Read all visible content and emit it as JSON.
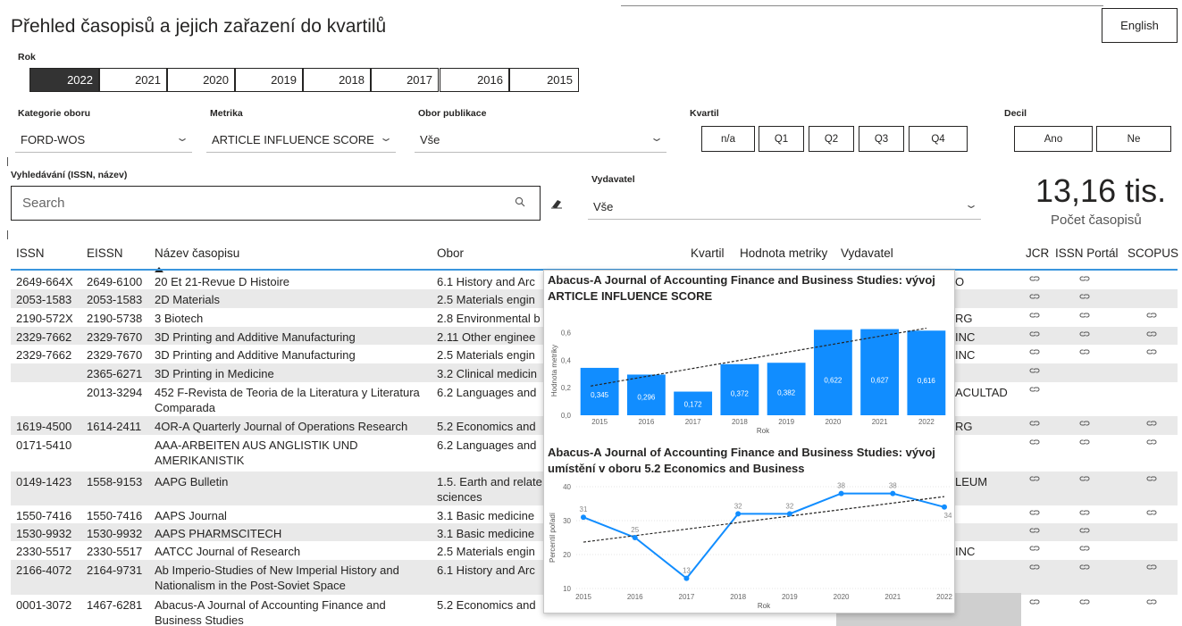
{
  "header": {
    "title": "Přehled časopisů a jejich zařazení do kvartilů",
    "language_button": "English"
  },
  "filters": {
    "year_label": "Rok",
    "years": [
      "2022",
      "2021",
      "2020",
      "2019",
      "2018",
      "2017",
      "2016",
      "2015"
    ],
    "selected_year": "2022",
    "category_label": "Kategorie oboru",
    "category_value": "FORD-WOS",
    "metric_label": "Metrika",
    "metric_value": "ARTICLE INFLUENCE SCORE",
    "field_label": "Obor publikace",
    "field_value": "Vše",
    "quartile_label": "Kvartil",
    "quartiles": [
      "n/a",
      "Q1",
      "Q2",
      "Q3",
      "Q4"
    ],
    "decile_label": "Decil",
    "deciles": [
      "Ano",
      "Ne"
    ],
    "search_label": "Vyhledávání (ISSN, název)",
    "search_placeholder": "Search",
    "publisher_label": "Vydavatel",
    "publisher_value": "Vše"
  },
  "kpi": {
    "value": "13,16 tis.",
    "label": "Počet časopisů"
  },
  "table": {
    "columns": {
      "issn": "ISSN",
      "eissn": "EISSN",
      "name": "Název časopisu",
      "field": "Obor",
      "quartile": "Kvartil",
      "metric": "Hodnota metriky",
      "publisher": "Vydavatel",
      "jcr": "JCR",
      "issn_portal": "ISSN Portál",
      "scopus": "SCOPUS"
    },
    "rows": [
      {
        "issn": "2649-664X",
        "eissn": "2649-6100",
        "name": "20 Et 21-Revue D Histoire",
        "field": "6.1 History and Arc",
        "publisher": "O",
        "jcr": true,
        "portal": true,
        "scopus": false
      },
      {
        "issn": "2053-1583",
        "eissn": "2053-1583",
        "name": "2D Materials",
        "field": "2.5 Materials engin",
        "publisher": "",
        "jcr": true,
        "portal": true,
        "scopus": false
      },
      {
        "issn": "2190-572X",
        "eissn": "2190-5738",
        "name": "3 Biotech",
        "field": "2.8 Environmental b",
        "publisher": "RG",
        "jcr": true,
        "portal": true,
        "scopus": true
      },
      {
        "issn": "2329-7662",
        "eissn": "2329-7670",
        "name": "3D Printing and Additive Manufacturing",
        "field": "2.11 Other enginee",
        "publisher": "INC",
        "jcr": true,
        "portal": true,
        "scopus": true
      },
      {
        "issn": "2329-7662",
        "eissn": "2329-7670",
        "name": "3D Printing and Additive Manufacturing",
        "field": "2.5 Materials engin",
        "publisher": "INC",
        "jcr": true,
        "portal": true,
        "scopus": true
      },
      {
        "issn": "",
        "eissn": "2365-6271",
        "name": "3D Printing in Medicine",
        "field": "3.2 Clinical medicin",
        "publisher": "",
        "jcr": true,
        "portal": false,
        "scopus": false
      },
      {
        "issn": "",
        "eissn": "2013-3294",
        "name": "452 F-Revista de Teoria de la Literatura y Literatura Comparada",
        "field": "6.2 Languages and",
        "publisher": "ACULTAD",
        "jcr": true,
        "portal": false,
        "scopus": false
      },
      {
        "issn": "1619-4500",
        "eissn": "1614-2411",
        "name": "4OR-A Quarterly Journal of Operations Research",
        "field": "5.2 Economics and",
        "publisher": "RG",
        "jcr": true,
        "portal": true,
        "scopus": true
      },
      {
        "issn": "0171-5410",
        "eissn": "",
        "name": "AAA-ARBEITEN AUS ANGLISTIK UND AMERIKANISTIK",
        "field": "6.2 Languages and",
        "publisher": "",
        "jcr": true,
        "portal": true,
        "scopus": true
      },
      {
        "issn": "0149-1423",
        "eissn": "1558-9153",
        "name": "AAPG Bulletin",
        "field": "1.5. Earth and relate sciences",
        "publisher": "LEUM",
        "jcr": true,
        "portal": true,
        "scopus": true
      },
      {
        "issn": "1550-7416",
        "eissn": "1550-7416",
        "name": "AAPS Journal",
        "field": "3.1 Basic medicine",
        "publisher": "",
        "jcr": true,
        "portal": true,
        "scopus": true
      },
      {
        "issn": "1530-9932",
        "eissn": "1530-9932",
        "name": "AAPS PHARMSCITECH",
        "field": "3.1 Basic medicine",
        "publisher": "",
        "jcr": true,
        "portal": true,
        "scopus": false
      },
      {
        "issn": "2330-5517",
        "eissn": "2330-5517",
        "name": "AATCC Journal of Research",
        "field": "2.5 Materials engin",
        "publisher": "INC",
        "jcr": true,
        "portal": true,
        "scopus": false
      },
      {
        "issn": "2166-4072",
        "eissn": "2164-9731",
        "name": "Ab Imperio-Studies of New Imperial History and Nationalism in the Post-Soviet Space",
        "field": "6.1 History and Arc",
        "publisher": "",
        "jcr": true,
        "portal": true,
        "scopus": true
      },
      {
        "issn": "0001-3072",
        "eissn": "1467-6281",
        "name": "Abacus-A Journal of Accounting Finance and Business Studies",
        "field": "5.2 Economics and",
        "publisher": "",
        "jcr": true,
        "portal": true,
        "scopus": true
      }
    ]
  },
  "tooltip": {
    "chart1_title_line1": "Abacus-A Journal of Accounting Finance and Business Studies: vývoj",
    "chart1_title_line2": "ARTICLE INFLUENCE SCORE",
    "chart2_title_line1": "Abacus-A Journal of Accounting Finance and Business Studies: vývoj",
    "chart2_title_line2": "umístění v oboru 5.2 Economics and Business"
  },
  "colors": {
    "accent": "#118dff",
    "header_underline": "#3a96dd",
    "selected_year_bg": "#333333"
  },
  "chart_data": [
    {
      "type": "bar",
      "title": "Abacus-A Journal of Accounting Finance and Business Studies: vývoj ARTICLE INFLUENCE SCORE",
      "categories": [
        "2015",
        "2016",
        "2017",
        "2018",
        "2019",
        "2020",
        "2021",
        "2022"
      ],
      "values": [
        0.345,
        0.296,
        0.172,
        0.372,
        0.382,
        0.622,
        0.627,
        0.616
      ],
      "labels": [
        "0,345",
        "0,296",
        "0,172",
        "0,372",
        "0,382",
        "0,622",
        "0,627",
        "0,616"
      ],
      "xlabel": "Rok",
      "ylabel": "Hodnota metriky",
      "yticks": [
        "0,0",
        "0,2",
        "0,4",
        "0,6"
      ],
      "ylim": [
        0,
        0.65
      ],
      "trendline": true
    },
    {
      "type": "line",
      "title": "Abacus-A Journal of Accounting Finance and Business Studies: vývoj umístění v oboru 5.2 Economics and Business",
      "categories": [
        "2015",
        "2016",
        "2017",
        "2018",
        "2019",
        "2020",
        "2021",
        "2022"
      ],
      "values": [
        31,
        25,
        13,
        32,
        32,
        38,
        38,
        34
      ],
      "xlabel": "Rok",
      "ylabel": "Percentil pořadí",
      "yticks": [
        "10",
        "20",
        "30",
        "40"
      ],
      "ylim": [
        10,
        40
      ],
      "trendline": true
    }
  ]
}
